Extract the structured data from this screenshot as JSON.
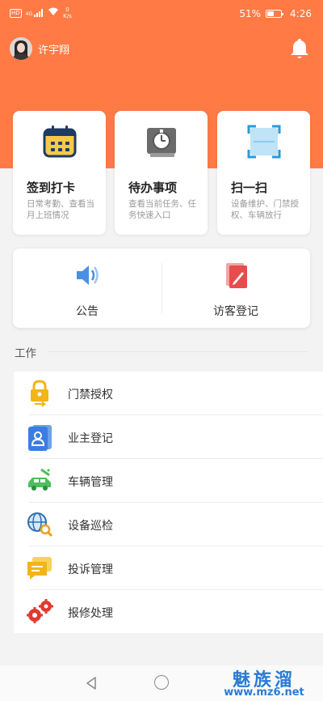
{
  "status_bar": {
    "left_badge": "HD",
    "signal": "4G",
    "speed_value": "0",
    "speed_unit": "K/s",
    "battery_percent": "51%",
    "battery_level": 0.51,
    "time": "4:26"
  },
  "header": {
    "user_name": "许宇翔",
    "bell_icon": "bell-icon",
    "bg_color": "#ff7a45"
  },
  "top_cards": [
    {
      "title": "签到打卡",
      "desc": "日常考勤、查看当月上班情况",
      "icon": "calendar-icon"
    },
    {
      "title": "待办事项",
      "desc": "查看当前任务、任务快速入口",
      "icon": "stopwatch-book-icon"
    },
    {
      "title": "扫一扫",
      "desc": "设备维护、门禁授权、车辆放行",
      "icon": "scan-icon"
    }
  ],
  "announce": [
    {
      "label": "公告",
      "icon": "speaker-icon"
    },
    {
      "label": "访客登记",
      "icon": "visitor-form-icon"
    }
  ],
  "work": {
    "title": "工作",
    "items": [
      {
        "label": "门禁授权",
        "icon": "lock-icon"
      },
      {
        "label": "业主登记",
        "icon": "owner-card-icon"
      },
      {
        "label": "车辆管理",
        "icon": "car-wrench-icon"
      },
      {
        "label": "设备巡检",
        "icon": "globe-search-icon"
      },
      {
        "label": "投诉管理",
        "icon": "chat-icon"
      },
      {
        "label": "报修处理",
        "icon": "gears-icon"
      }
    ]
  },
  "watermark": {
    "brand": "魅族溜",
    "url": "www.mz6.net"
  }
}
